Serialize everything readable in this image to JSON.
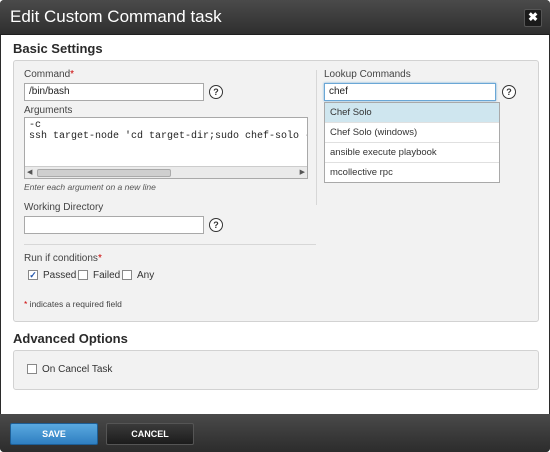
{
  "dialog": {
    "title": "Edit Custom Command task",
    "close_symbol": "✖"
  },
  "basic_settings": {
    "heading": "Basic Settings",
    "command": {
      "label": "Command",
      "required_marker": "*",
      "value": "/bin/bash"
    },
    "arguments": {
      "label": "Arguments",
      "value": "-c\nssh target-node 'cd target-dir;sudo chef-solo -c c",
      "hint": "Enter each argument on a new line"
    },
    "working_directory": {
      "label": "Working Directory",
      "value": ""
    },
    "run_if": {
      "label": "Run if conditions",
      "required_marker": "*",
      "options": [
        {
          "label": "Passed",
          "checked": true
        },
        {
          "label": "Failed",
          "checked": false
        },
        {
          "label": "Any",
          "checked": false
        }
      ]
    },
    "required_note": {
      "marker": "*",
      "text": " indicates a required field"
    },
    "lookup": {
      "label": "Lookup Commands",
      "value": "chef",
      "results": [
        "Chef Solo",
        "Chef Solo (windows)",
        "ansible execute playbook",
        "mcollective rpc"
      ],
      "selected_index": 0
    },
    "help_symbol": "?"
  },
  "advanced_options": {
    "heading": "Advanced Options",
    "on_cancel": {
      "label": "On Cancel Task",
      "checked": false
    }
  },
  "footer": {
    "save_label": "SAVE",
    "cancel_label": "CANCEL"
  },
  "icons": {
    "close": "close-icon",
    "help": "help-icon",
    "checkbox_checked": "checkmark-icon"
  },
  "colors": {
    "title_bar": "#3a3a3a",
    "save_button": "#3b8fd0",
    "required": "#cc0000",
    "dropdown_selected": "#cfe6ef"
  }
}
